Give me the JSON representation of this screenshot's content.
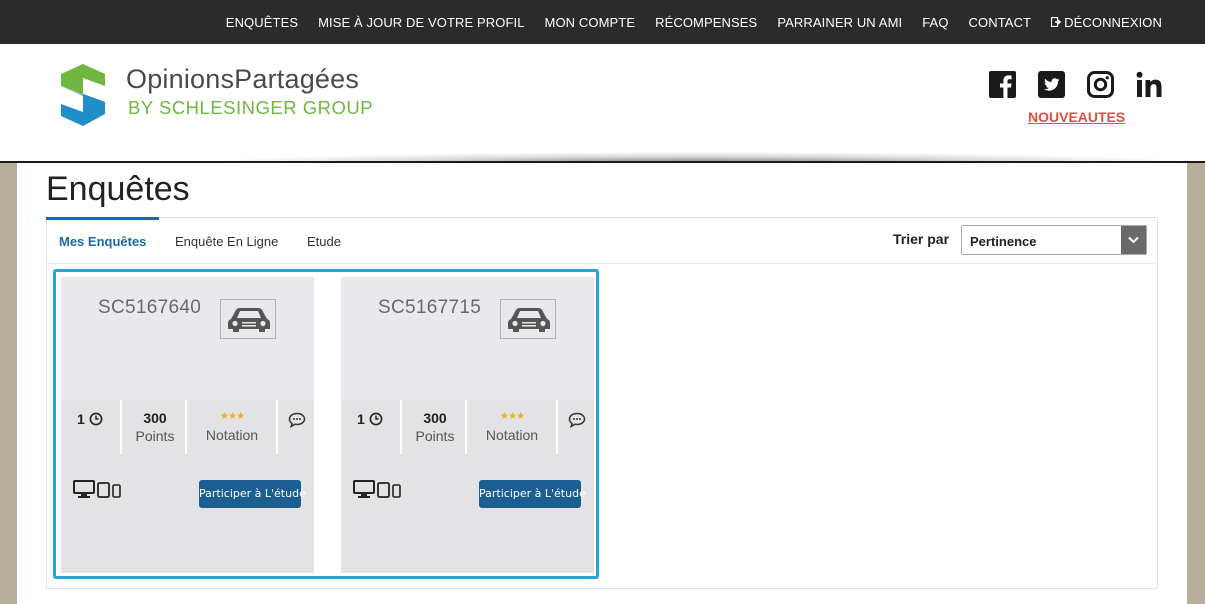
{
  "topnav": {
    "items": [
      "ENQUÊTES",
      "MISE À JOUR DE VOTRE PROFIL",
      "MON COMPTE",
      "RÉCOMPENSES",
      "PARRAINER UN AMI",
      "FAQ",
      "CONTACT"
    ],
    "logout": "DÉCONNEXION"
  },
  "brand": {
    "name": "OpinionsPartagées",
    "sub": "BY SCHLESINGER GROUP",
    "green": "#6fb73f",
    "blue": "#1e8fc9"
  },
  "social": {
    "icons": [
      "facebook-icon",
      "twitter-icon",
      "instagram-icon",
      "linkedin-icon"
    ],
    "news_link": "NOUVEAUTES"
  },
  "page": {
    "title": "Enquêtes",
    "tabs": [
      "Mes Enquêtes",
      "Enquête En Ligne",
      "Etude"
    ],
    "sort_label": "Trier par",
    "sort_value": "Pertinence"
  },
  "surveys": [
    {
      "code": "SC5167640",
      "duration": "1",
      "points": "300",
      "points_label": "Points",
      "stars": "★★★",
      "rating_label": "Notation",
      "button": "Participer à L'étude"
    },
    {
      "code": "SC5167715",
      "duration": "1",
      "points": "300",
      "points_label": "Points",
      "stars": "★★★",
      "rating_label": "Notation",
      "button": "Participer à L'étude"
    }
  ],
  "colors": {
    "accent": "#1e6aa6",
    "selection_border": "#2aa3d6",
    "news_red": "#d9523f",
    "stars": "#f2b01e"
  }
}
